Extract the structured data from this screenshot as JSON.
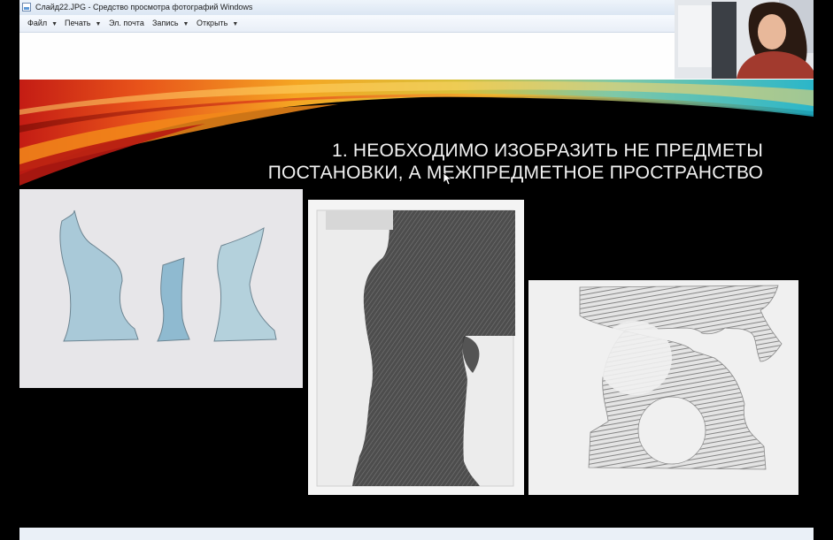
{
  "window": {
    "title": "Слайд22.JPG - Средство просмотра фотографий Windows",
    "app_icon": "photo-viewer-icon"
  },
  "menu": {
    "items": [
      {
        "label": "Файл",
        "has_dropdown": true
      },
      {
        "label": "Печать",
        "has_dropdown": true
      },
      {
        "label": "Эл. почта",
        "has_dropdown": false
      },
      {
        "label": "Запись",
        "has_dropdown": true
      },
      {
        "label": "Открыть",
        "has_dropdown": true
      }
    ],
    "dropdown_glyph": "▼"
  },
  "slide": {
    "title": "1. НЕОБХОДИМО ИЗОБРАЗИТЬ НЕ ПРЕДМЕТЫ\nПОСТАНОВКИ, А МЕЖПРЕДМЕТНОЕ ПРОСТРАНСТВО",
    "background": "#000000",
    "images": [
      {
        "name": "blue-watercolor-negative-space-drawing"
      },
      {
        "name": "graphite-shaded-negative-space-drawing"
      },
      {
        "name": "hatched-negative-space-drawing"
      }
    ]
  },
  "webcam": {
    "name": "presenter-webcam-overlay"
  },
  "colors": {
    "titlebar": "#dbe6f3",
    "menubar": "#e8eef7",
    "swoosh_orange": "#f28a1a",
    "swoosh_red": "#c8201a",
    "swoosh_teal": "#2bb6c9",
    "slide_text": "#f2f2f2"
  }
}
